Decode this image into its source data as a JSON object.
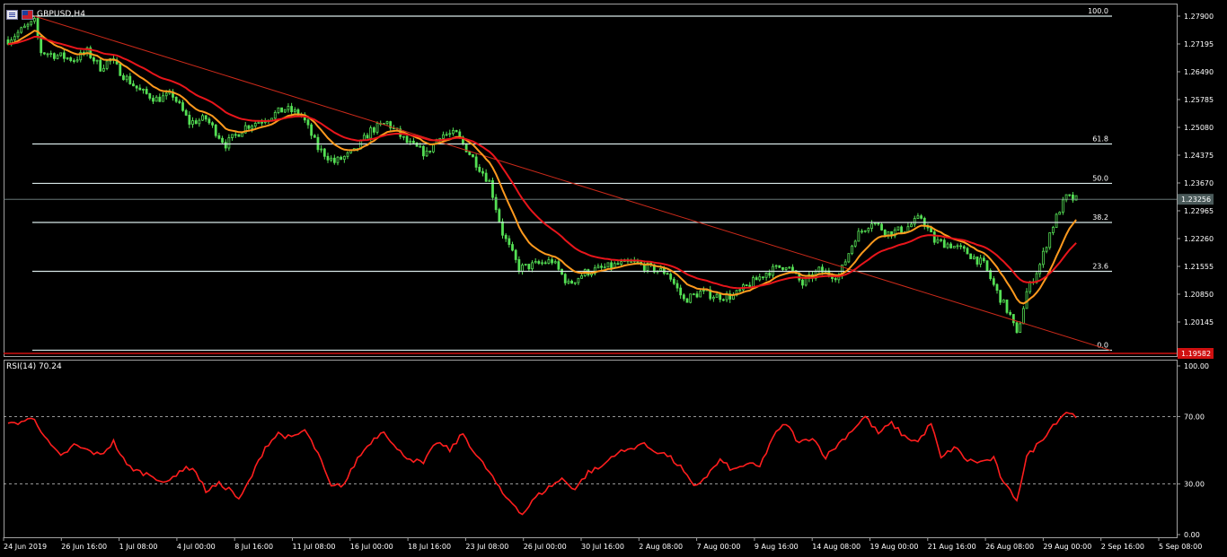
{
  "header": {
    "symbol_label": "GBPUSD,H4"
  },
  "colors": {
    "candle_up": "#55e055",
    "candle_down": "#55e055",
    "ma_fast": "#ff9a1e",
    "ma_slow": "#e8151b",
    "trendline": "#cc2a1a",
    "fib_lines": "#d8e8e8",
    "rsi_line": "#ff1e1e",
    "price_marker": "#4a5a5a",
    "low_marker": "#d01010"
  },
  "chart_data": [
    {
      "type": "candlestick",
      "title": "GBPUSD,H4",
      "price_axis_ticks": [
        "1.27900",
        "1.27195",
        "1.26490",
        "1.25785",
        "1.25080",
        "1.24375",
        "1.23670",
        "1.22965",
        "1.22260",
        "1.21555",
        "1.20850",
        "1.20145"
      ],
      "ylim": [
        1.1956,
        1.2807
      ],
      "time_axis_ticks": [
        "24 Jun 2019",
        "26 Jun 16:00",
        "1 Jul 08:00",
        "4 Jul 00:00",
        "8 Jul 16:00",
        "11 Jul 08:00",
        "16 Jul 00:00",
        "18 Jul 16:00",
        "23 Jul 08:00",
        "26 Jul 00:00",
        "30 Jul 16:00",
        "2 Aug 08:00",
        "7 Aug 00:00",
        "9 Aug 16:00",
        "14 Aug 08:00",
        "19 Aug 00:00",
        "21 Aug 16:00",
        "26 Aug 08:00",
        "29 Aug 00:00",
        "2 Sep 16:00",
        "5 Sep 08:00"
      ],
      "current_price": "1.23256",
      "low_price_marker": "1.19582",
      "close_path": [
        {
          "bar": 0,
          "price": 1.273
        },
        {
          "bar": 5,
          "price": 1.276
        },
        {
          "bar": 8,
          "price": 1.2775
        },
        {
          "bar": 10,
          "price": 1.27
        },
        {
          "bar": 15,
          "price": 1.269
        },
        {
          "bar": 20,
          "price": 1.268
        },
        {
          "bar": 24,
          "price": 1.27
        },
        {
          "bar": 28,
          "price": 1.266
        },
        {
          "bar": 31,
          "price": 1.268
        },
        {
          "bar": 35,
          "price": 1.264
        },
        {
          "bar": 40,
          "price": 1.26
        },
        {
          "bar": 45,
          "price": 1.258
        },
        {
          "bar": 50,
          "price": 1.259
        },
        {
          "bar": 55,
          "price": 1.252
        },
        {
          "bar": 60,
          "price": 1.253
        },
        {
          "bar": 66,
          "price": 1.2465
        },
        {
          "bar": 72,
          "price": 1.251
        },
        {
          "bar": 78,
          "price": 1.253
        },
        {
          "bar": 84,
          "price": 1.2555
        },
        {
          "bar": 89,
          "price": 1.254
        },
        {
          "bar": 94,
          "price": 1.2455
        },
        {
          "bar": 99,
          "price": 1.242
        },
        {
          "bar": 105,
          "price": 1.2445
        },
        {
          "bar": 110,
          "price": 1.25
        },
        {
          "bar": 115,
          "price": 1.252
        },
        {
          "bar": 121,
          "price": 1.247
        },
        {
          "bar": 127,
          "price": 1.244
        },
        {
          "bar": 131,
          "price": 1.249
        },
        {
          "bar": 136,
          "price": 1.249
        },
        {
          "bar": 141,
          "price": 1.243
        },
        {
          "bar": 146,
          "price": 1.237
        },
        {
          "bar": 150,
          "price": 1.224
        },
        {
          "bar": 155,
          "price": 1.215
        },
        {
          "bar": 160,
          "price": 1.216
        },
        {
          "bar": 165,
          "price": 1.217
        },
        {
          "bar": 170,
          "price": 1.211
        },
        {
          "bar": 175,
          "price": 1.214
        },
        {
          "bar": 180,
          "price": 1.215
        },
        {
          "bar": 185,
          "price": 1.216
        },
        {
          "bar": 190,
          "price": 1.2165
        },
        {
          "bar": 195,
          "price": 1.215
        },
        {
          "bar": 200,
          "price": 1.214
        },
        {
          "bar": 205,
          "price": 1.207
        },
        {
          "bar": 210,
          "price": 1.209
        },
        {
          "bar": 215,
          "price": 1.208
        },
        {
          "bar": 220,
          "price": 1.208
        },
        {
          "bar": 225,
          "price": 1.211
        },
        {
          "bar": 230,
          "price": 1.214
        },
        {
          "bar": 236,
          "price": 1.216
        },
        {
          "bar": 241,
          "price": 1.211
        },
        {
          "bar": 246,
          "price": 1.2145
        },
        {
          "bar": 252,
          "price": 1.213
        },
        {
          "bar": 257,
          "price": 1.223
        },
        {
          "bar": 262,
          "price": 1.227
        },
        {
          "bar": 267,
          "price": 1.224
        },
        {
          "bar": 272,
          "price": 1.225
        },
        {
          "bar": 277,
          "price": 1.228
        },
        {
          "bar": 281,
          "price": 1.222
        },
        {
          "bar": 286,
          "price": 1.221
        },
        {
          "bar": 291,
          "price": 1.219
        },
        {
          "bar": 296,
          "price": 1.216
        },
        {
          "bar": 300,
          "price": 1.209
        },
        {
          "bar": 304,
          "price": 1.203
        },
        {
          "bar": 306,
          "price": 1.198
        },
        {
          "bar": 309,
          "price": 1.209
        },
        {
          "bar": 313,
          "price": 1.216
        },
        {
          "bar": 316,
          "price": 1.224
        },
        {
          "bar": 319,
          "price": 1.23
        },
        {
          "bar": 321,
          "price": 1.233
        },
        {
          "bar": 324,
          "price": 1.2325
        }
      ],
      "moving_averages": [
        "fast",
        "slow"
      ]
    },
    {
      "type": "line",
      "title": "RSI(14) 70.24",
      "indicator": "RSI(14)",
      "last_value": "70.24",
      "ylim": [
        0,
        100
      ],
      "axis_ticks": [
        "100.00",
        "70.00",
        "30.00",
        "0.00"
      ],
      "levels": [
        70,
        30
      ],
      "values": [
        {
          "bar": 0,
          "value": 65
        },
        {
          "bar": 4,
          "value": 67
        },
        {
          "bar": 8,
          "value": 69
        },
        {
          "bar": 12,
          "value": 55
        },
        {
          "bar": 16,
          "value": 46
        },
        {
          "bar": 20,
          "value": 53
        },
        {
          "bar": 24,
          "value": 50
        },
        {
          "bar": 28,
          "value": 47
        },
        {
          "bar": 32,
          "value": 55
        },
        {
          "bar": 36,
          "value": 41
        },
        {
          "bar": 40,
          "value": 37
        },
        {
          "bar": 44,
          "value": 35
        },
        {
          "bar": 48,
          "value": 30
        },
        {
          "bar": 52,
          "value": 38
        },
        {
          "bar": 56,
          "value": 40
        },
        {
          "bar": 60,
          "value": 26
        },
        {
          "bar": 64,
          "value": 30
        },
        {
          "bar": 68,
          "value": 26
        },
        {
          "bar": 70,
          "value": 20
        },
        {
          "bar": 74,
          "value": 35
        },
        {
          "bar": 78,
          "value": 52
        },
        {
          "bar": 82,
          "value": 60
        },
        {
          "bar": 86,
          "value": 57
        },
        {
          "bar": 90,
          "value": 62
        },
        {
          "bar": 94,
          "value": 48
        },
        {
          "bar": 98,
          "value": 28
        },
        {
          "bar": 102,
          "value": 30
        },
        {
          "bar": 106,
          "value": 45
        },
        {
          "bar": 110,
          "value": 55
        },
        {
          "bar": 114,
          "value": 62
        },
        {
          "bar": 118,
          "value": 50
        },
        {
          "bar": 122,
          "value": 45
        },
        {
          "bar": 126,
          "value": 42
        },
        {
          "bar": 130,
          "value": 55
        },
        {
          "bar": 134,
          "value": 50
        },
        {
          "bar": 138,
          "value": 60
        },
        {
          "bar": 142,
          "value": 47
        },
        {
          "bar": 146,
          "value": 37
        },
        {
          "bar": 150,
          "value": 24
        },
        {
          "bar": 154,
          "value": 17
        },
        {
          "bar": 156,
          "value": 12
        },
        {
          "bar": 160,
          "value": 22
        },
        {
          "bar": 164,
          "value": 28
        },
        {
          "bar": 168,
          "value": 33
        },
        {
          "bar": 172,
          "value": 27
        },
        {
          "bar": 176,
          "value": 37
        },
        {
          "bar": 180,
          "value": 40
        },
        {
          "bar": 184,
          "value": 48
        },
        {
          "bar": 188,
          "value": 50
        },
        {
          "bar": 192,
          "value": 54
        },
        {
          "bar": 196,
          "value": 50
        },
        {
          "bar": 200,
          "value": 47
        },
        {
          "bar": 204,
          "value": 40
        },
        {
          "bar": 208,
          "value": 28
        },
        {
          "bar": 212,
          "value": 35
        },
        {
          "bar": 216,
          "value": 44
        },
        {
          "bar": 220,
          "value": 38
        },
        {
          "bar": 224,
          "value": 42
        },
        {
          "bar": 228,
          "value": 40
        },
        {
          "bar": 232,
          "value": 58
        },
        {
          "bar": 236,
          "value": 66
        },
        {
          "bar": 240,
          "value": 54
        },
        {
          "bar": 244,
          "value": 58
        },
        {
          "bar": 248,
          "value": 46
        },
        {
          "bar": 252,
          "value": 54
        },
        {
          "bar": 256,
          "value": 62
        },
        {
          "bar": 260,
          "value": 70
        },
        {
          "bar": 264,
          "value": 60
        },
        {
          "bar": 268,
          "value": 66
        },
        {
          "bar": 272,
          "value": 58
        },
        {
          "bar": 276,
          "value": 55
        },
        {
          "bar": 280,
          "value": 66
        },
        {
          "bar": 283,
          "value": 45
        },
        {
          "bar": 287,
          "value": 52
        },
        {
          "bar": 291,
          "value": 44
        },
        {
          "bar": 295,
          "value": 43
        },
        {
          "bar": 299,
          "value": 45
        },
        {
          "bar": 302,
          "value": 30
        },
        {
          "bar": 306,
          "value": 21
        },
        {
          "bar": 309,
          "value": 46
        },
        {
          "bar": 313,
          "value": 55
        },
        {
          "bar": 317,
          "value": 65
        },
        {
          "bar": 321,
          "value": 73
        },
        {
          "bar": 324,
          "value": 70
        }
      ]
    }
  ],
  "fibonacci": [
    {
      "label": "100.0",
      "price": 1.279
    },
    {
      "label": "61.8",
      "price": 1.2466
    },
    {
      "label": "50.0",
      "price": 1.2366
    },
    {
      "label": "38.2",
      "price": 1.2267
    },
    {
      "label": "23.6",
      "price": 1.2143
    },
    {
      "label": "0.0",
      "price": 1.1943
    }
  ]
}
